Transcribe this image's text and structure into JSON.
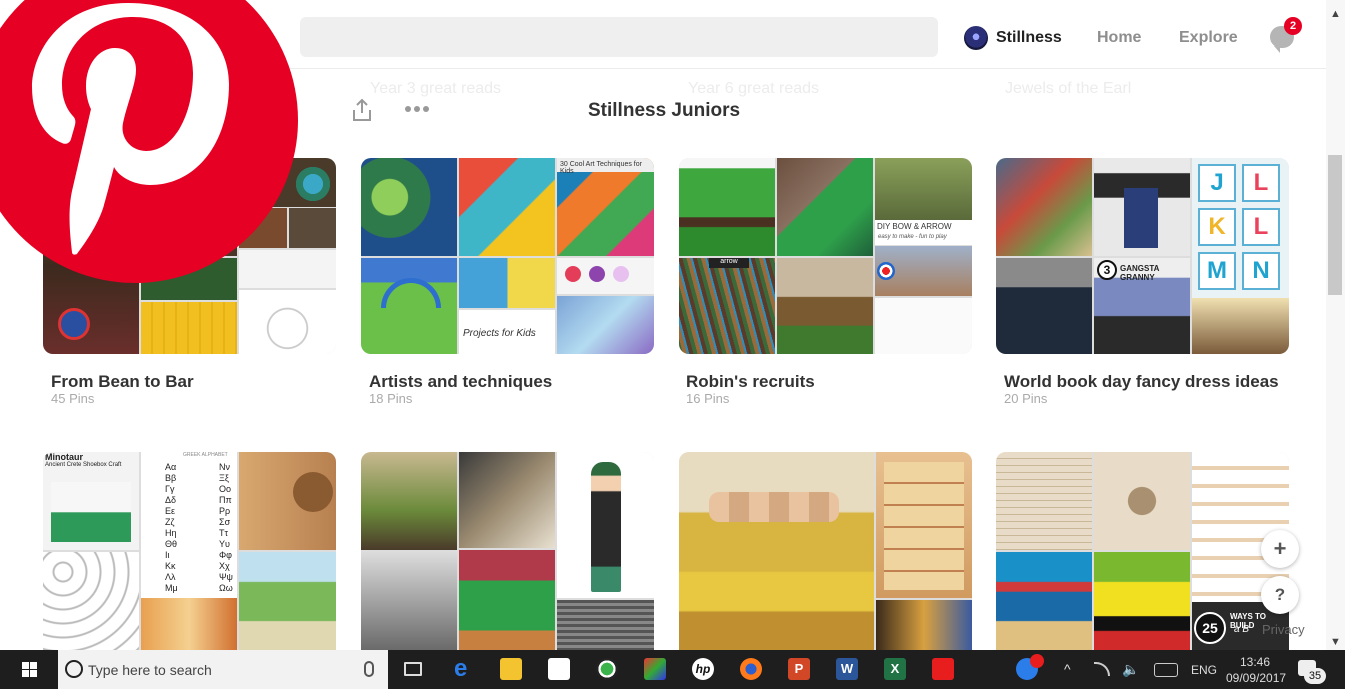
{
  "header": {
    "user_name": "Stillness",
    "nav": [
      "Home",
      "Explore"
    ],
    "notification_count": "2"
  },
  "faint_titles": [
    "Year 3 great reads",
    "Year 6 great reads",
    "Jewels of the Earl"
  ],
  "page_title": "Stillness Juniors",
  "boards": [
    {
      "name": "From Bean to Bar",
      "count": "45 Pins"
    },
    {
      "name": "Artists and techniques",
      "count": "18 Pins"
    },
    {
      "name": "Robin's recruits",
      "count": "16 Pins"
    },
    {
      "name": "World book day fancy dress ideas",
      "count": "20 Pins"
    }
  ],
  "thumb_text": {
    "art_heading": "30 Cool Art Techniques for Kids",
    "art_projects": "Projects for Kids",
    "bow": "DIY BOW & ARROW",
    "bow_sub": "easy to make - fun to play",
    "arrow": "arrow",
    "gangsta": "GANGSTA GRANNY",
    "gangsta_num": "3",
    "minotaur": "Minotaur",
    "minotaur_sub": "Ancient Crete Shoebox Craft",
    "greek_left": [
      "Αα",
      "Ββ",
      "Γγ",
      "Δδ",
      "Εε",
      "Ζζ",
      "Ηη",
      "Θθ",
      "Ιι",
      "Κκ",
      "Λλ",
      "Μμ"
    ],
    "greek_right": [
      "Νν",
      "Ξξ",
      "Οο",
      "Ππ",
      "Ρρ",
      "Σσ",
      "Ττ",
      "Υυ",
      "Φφ",
      "Χχ",
      "Ψψ",
      "Ωω"
    ],
    "alphabet": "GREEK ALPHABET",
    "build_num": "25",
    "build_text": "WAYS TO BUILD",
    "build_sub": "a B"
  },
  "fab": {
    "add": "+",
    "help": "?",
    "privacy": "Privacy"
  },
  "taskbar": {
    "search_placeholder": "Type here to search",
    "lang": "ENG",
    "time": "13:46",
    "date": "09/09/2017",
    "notif": "35"
  },
  "colors": {
    "pinterest_red": "#e60023",
    "taskbar": "#1e1e1e"
  }
}
